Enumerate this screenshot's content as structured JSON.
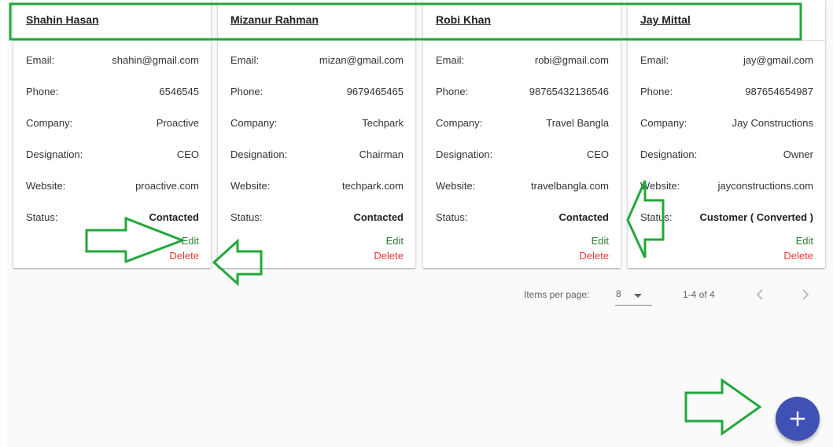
{
  "labels": {
    "email": "Email:",
    "phone": "Phone:",
    "company": "Company:",
    "designation": "Designation:",
    "website": "Website:",
    "status": "Status:",
    "edit": "Edit",
    "delete": "Delete"
  },
  "contacts": [
    {
      "name": "Shahin Hasan",
      "email": "shahin@gmail.com",
      "phone": "6546545",
      "company": "Proactive",
      "designation": "CEO",
      "website": "proactive.com",
      "status": "Contacted"
    },
    {
      "name": "Mizanur Rahman",
      "email": "mizan@gmail.com",
      "phone": "9679465465",
      "company": "Techpark",
      "designation": "Chairman",
      "website": "techpark.com",
      "status": "Contacted"
    },
    {
      "name": "Robi Khan",
      "email": "robi@gmail.com",
      "phone": "98765432136546",
      "company": "Travel Bangla",
      "designation": "CEO",
      "website": "travelbangla.com",
      "status": "Contacted"
    },
    {
      "name": "Jay Mittal",
      "email": "jay@gmail.com",
      "phone": "987654654987",
      "company": "Jay Constructions",
      "designation": "Owner",
      "website": "jayconstructions.com",
      "status": "Customer ( Converted )"
    }
  ],
  "paginator": {
    "items_per_page_label": "Items per page:",
    "page_size": "8",
    "range_label": "1-4 of 4"
  },
  "colors": {
    "edit": "#2e7d32",
    "delete": "#e53935",
    "fab": "#3f51b5",
    "annotation": "#22a83a"
  },
  "icons": {
    "fab": "plus-icon",
    "prev": "chevron-left-icon",
    "next": "chevron-right-icon",
    "dropdown": "caret-down-icon"
  }
}
